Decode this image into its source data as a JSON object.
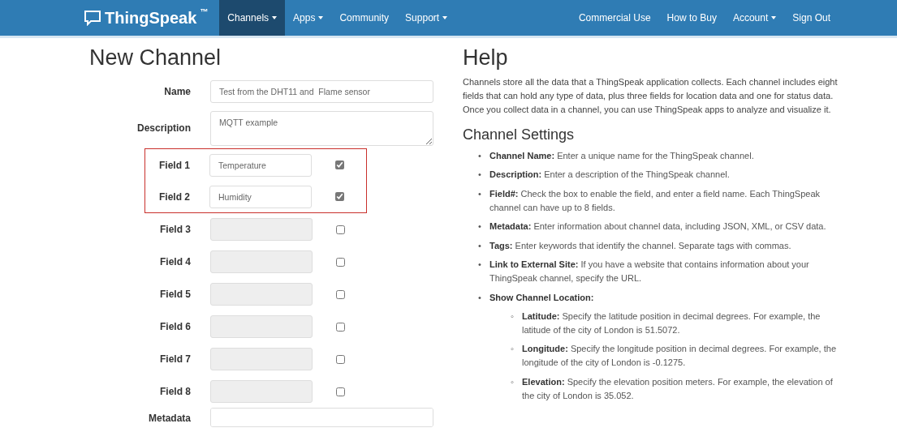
{
  "navbar": {
    "brand": "ThingSpeak",
    "brand_mark": "™",
    "left_items": [
      {
        "label": "Channels",
        "dropdown": true,
        "selected": true
      },
      {
        "label": "Apps",
        "dropdown": true,
        "selected": false
      },
      {
        "label": "Community",
        "dropdown": false,
        "selected": false
      },
      {
        "label": "Support",
        "dropdown": true,
        "selected": false
      }
    ],
    "right_items": [
      {
        "label": "Commercial Use",
        "dropdown": false,
        "selected": false
      },
      {
        "label": "How to Buy",
        "dropdown": false,
        "selected": false
      },
      {
        "label": "Account",
        "dropdown": true,
        "selected": false
      },
      {
        "label": "Sign Out",
        "dropdown": false,
        "selected": false
      }
    ]
  },
  "form": {
    "title": "New Channel",
    "name": {
      "label": "Name",
      "value": "Test from the DHT11 and  Flame sensor"
    },
    "description": {
      "label": "Description",
      "value": "MQTT example"
    },
    "fields": [
      {
        "label": "Field 1",
        "value": "Temperature",
        "checked": true,
        "disabled": false,
        "highlighted": true
      },
      {
        "label": "Field 2",
        "value": "Humidity",
        "checked": true,
        "disabled": false,
        "highlighted": true
      },
      {
        "label": "Field 3",
        "checked": false,
        "disabled": true,
        "highlighted": false
      },
      {
        "label": "Field 4",
        "checked": false,
        "disabled": true,
        "highlighted": false
      },
      {
        "label": "Field 5",
        "checked": false,
        "disabled": true,
        "highlighted": false
      },
      {
        "label": "Field 6",
        "checked": false,
        "disabled": true,
        "highlighted": false
      },
      {
        "label": "Field 7",
        "checked": false,
        "disabled": true,
        "highlighted": false
      },
      {
        "label": "Field 8",
        "checked": false,
        "disabled": true,
        "highlighted": false
      }
    ],
    "metadata": {
      "label": "Metadata"
    }
  },
  "help": {
    "title": "Help",
    "intro": "Channels store all the data that a ThingSpeak application collects. Each channel includes eight fields that can hold any type of data, plus three fields for location data and one for status data. Once you collect data in a channel, you can use ThingSpeak apps to analyze and visualize it.",
    "section_title": "Channel Settings",
    "items": [
      {
        "marker": "•",
        "term": "Channel Name:",
        "text": "Enter a unique name for the ThingSpeak channel."
      },
      {
        "marker": "•",
        "term": "Description:",
        "text": "Enter a description of the ThingSpeak channel."
      },
      {
        "marker": "•",
        "term": "Field#:",
        "text": "Check the box to enable the field, and enter a field name. Each ThingSpeak channel can have up to 8 fields."
      },
      {
        "marker": "•",
        "term": "Metadata:",
        "text": "Enter information about channel data, including JSON, XML, or CSV data."
      },
      {
        "marker": "•",
        "term": "Tags:",
        "text": "Enter keywords that identify the channel. Separate tags with commas."
      },
      {
        "marker": "•",
        "term": "Link to External Site:",
        "text": "If you have a website that contains information about your ThingSpeak channel, specify the URL."
      },
      {
        "marker": "•",
        "term": "Show Channel Location:",
        "children": [
          {
            "marker": "◦",
            "term": "Latitude:",
            "text": "Specify the latitude position in decimal degrees. For example, the latitude of the city of London is 51.5072."
          },
          {
            "marker": "◦",
            "term": "Longitude:",
            "text": "Specify the longitude position in decimal degrees. For example, the longitude of the city of London is -0.1275."
          },
          {
            "marker": "◦",
            "term": "Elevation:",
            "text": "Specify the elevation position meters. For example, the elevation of the city of London is 35.052."
          }
        ]
      }
    ]
  }
}
